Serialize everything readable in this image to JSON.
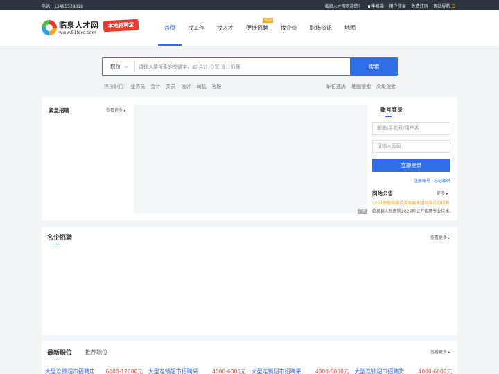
{
  "topbar": {
    "phone": "电话：13485538018",
    "welcome": "临泉人才网欢迎您！",
    "mobile": "手机端",
    "login": "用户登录",
    "register": "免费注册",
    "site_nav": "网站导航"
  },
  "header": {
    "logo_name": "临泉人才网",
    "logo_url": "www.51lqrc.com",
    "logo_badge": "本地招聘宝",
    "nav": [
      {
        "label": "首页"
      },
      {
        "label": "找工作"
      },
      {
        "label": "找人才"
      },
      {
        "label": "便捷招聘",
        "badge": "NEW"
      },
      {
        "label": "找企业"
      },
      {
        "label": "职场资讯"
      },
      {
        "label": "地图"
      }
    ]
  },
  "search": {
    "category": "职位",
    "placeholder": "请输入要搜索的关键字，如 会计,仓管,设计师等",
    "button": "搜索",
    "hot_label": "热搜职位:",
    "hot": [
      "业务员",
      "会计",
      "文员",
      "设计",
      "司机",
      "客服"
    ],
    "links": [
      "职位速历",
      "地图搜索",
      "高级搜索"
    ]
  },
  "urgent": {
    "title": "紧急招聘",
    "more": "查看更多",
    "ad": "广告"
  },
  "login": {
    "title": "账号登录",
    "user_placeholder": "邮箱/手机号/用户名",
    "pwd_placeholder": "请输入密码",
    "button": "立即登录",
    "register": "注册账号",
    "forgot": "忘记密码"
  },
  "notice": {
    "title": "网站公告",
    "more": "更多",
    "items": [
      "2021安徽临泉投资发展集团有限公司招聘",
      "临泉县人民医院2022年公开招聘专业技术人员"
    ],
    "highlight_color": "#f5a623"
  },
  "famous": {
    "title": "名企招聘",
    "more": "查看更多"
  },
  "latest": {
    "title": "最新职位",
    "tab2": "推荐职位",
    "more": "查看更多",
    "jobs": [
      {
        "title": "大型连锁超市招聘店",
        "salary": "6000-12000元"
      },
      {
        "title": "大型连锁超市招聘采",
        "salary": "4000-6000元"
      },
      {
        "title": "大型连锁超市招聘采",
        "salary": "4000-8000元"
      },
      {
        "title": "大型连锁超市招聘货",
        "salary": "4000-6000元"
      }
    ]
  }
}
